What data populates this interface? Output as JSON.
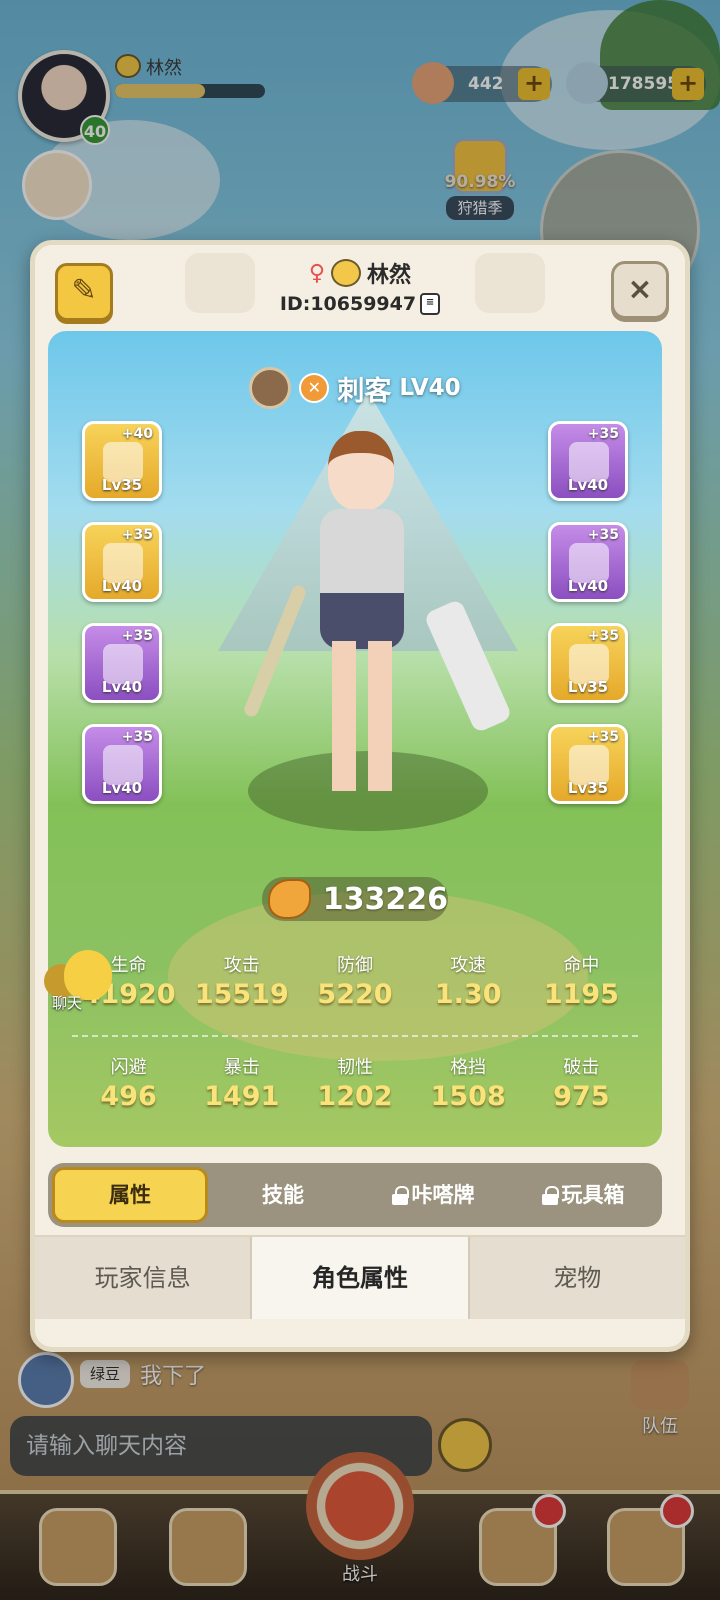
{
  "hud": {
    "player_name": "林然",
    "level": "40",
    "currency_1": "442",
    "currency_2": "178595",
    "season_percent": "90.98%",
    "season_label": "狩猎季",
    "xp_progress": 0.6
  },
  "modal": {
    "player_name": "林然",
    "player_id": "ID:10659947",
    "class_name": "刺客",
    "class_level": "LV40",
    "power": "133226",
    "equipment_left": [
      {
        "plus": "+40",
        "lv": "Lv35",
        "rarity": "gold"
      },
      {
        "plus": "+35",
        "lv": "Lv40",
        "rarity": "gold"
      },
      {
        "plus": "+35",
        "lv": "Lv40",
        "rarity": "purple"
      },
      {
        "plus": "+35",
        "lv": "Lv40",
        "rarity": "purple"
      }
    ],
    "equipment_right": [
      {
        "plus": "+35",
        "lv": "Lv40",
        "rarity": "purple"
      },
      {
        "plus": "+35",
        "lv": "Lv40",
        "rarity": "purple"
      },
      {
        "plus": "+35",
        "lv": "Lv35",
        "rarity": "gold"
      },
      {
        "plus": "+35",
        "lv": "Lv35",
        "rarity": "gold"
      }
    ],
    "stats_row1": [
      {
        "label": "生命",
        "value": "41920"
      },
      {
        "label": "攻击",
        "value": "15519"
      },
      {
        "label": "防御",
        "value": "5220"
      },
      {
        "label": "攻速",
        "value": "1.30"
      },
      {
        "label": "命中",
        "value": "1195"
      }
    ],
    "stats_row2": [
      {
        "label": "闪避",
        "value": "496"
      },
      {
        "label": "暴击",
        "value": "1491"
      },
      {
        "label": "韧性",
        "value": "1202"
      },
      {
        "label": "格挡",
        "value": "1508"
      },
      {
        "label": "破击",
        "value": "975"
      }
    ],
    "sub_tabs": [
      "属性",
      "技能",
      "咔嗒牌",
      "玩具箱"
    ],
    "main_tabs": [
      "玩家信息",
      "角色属性",
      "宠物"
    ],
    "close_label": "×",
    "chat_float_label": "聊天"
  },
  "chat": {
    "sender": "绿豆",
    "message": "我下了",
    "input_placeholder": "请输入聊天内容"
  },
  "team_label": "队伍",
  "nav": {
    "battle_label": "战斗"
  },
  "colors": {
    "gold_tab": "#f6d350",
    "stat_value": "#f9e37a",
    "equip_purple": "#8b4fc0",
    "equip_gold": "#e5a92a"
  }
}
